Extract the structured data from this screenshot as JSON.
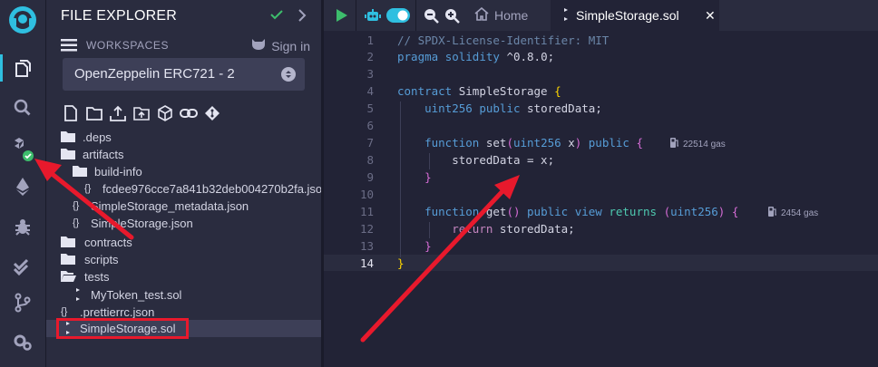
{
  "explorer": {
    "title": "FILE EXPLORER",
    "workspaces_label": "WORKSPACES",
    "sign_in_label": "Sign in",
    "workspace_selected": "OpenZeppelin ERC721 - 2"
  },
  "tree": [
    {
      "label": ".deps",
      "kind": "folder"
    },
    {
      "label": "artifacts",
      "kind": "folder"
    },
    {
      "label": "build-info",
      "kind": "folder"
    },
    {
      "label": "fcdee976cce7a841b32deb004270b2fa.json",
      "kind": "json"
    },
    {
      "label": "SimpleStorage_metadata.json",
      "kind": "json"
    },
    {
      "label": "SimpleStorage.json",
      "kind": "json"
    },
    {
      "label": "contracts",
      "kind": "folder"
    },
    {
      "label": "scripts",
      "kind": "folder"
    },
    {
      "label": "tests",
      "kind": "folder-open"
    },
    {
      "label": "MyToken_test.sol",
      "kind": "sol"
    },
    {
      "label": ".prettierrc.json",
      "kind": "json"
    },
    {
      "label": "SimpleStorage.sol",
      "kind": "sol",
      "selected": true
    }
  ],
  "tabs": {
    "home_label": "Home",
    "active_label": "SimpleStorage.sol",
    "close_glyph": "✕"
  },
  "editor": {
    "line_numbers": [
      "1",
      "2",
      "3",
      "4",
      "5",
      "6",
      "7",
      "8",
      "9",
      "10",
      "11",
      "12",
      "13",
      "14"
    ],
    "current_line": 14,
    "gas_set": "22514 gas",
    "gas_get": "2454 gas"
  },
  "colors": {
    "accent_green": "#3dbd6c",
    "highlight_red": "#e8192c",
    "toggle_blue": "#2fbfe0"
  },
  "icons": [
    "remix-logo-icon",
    "file-explorer-icon",
    "search-icon",
    "solidity-compiler-icon",
    "deploy-icon",
    "debugger-icon",
    "test-icon",
    "git-icon",
    "settings-icon",
    "hamburger-icon",
    "github-icon",
    "check-icon",
    "chevron-right-icon",
    "play-icon",
    "robot-icon",
    "toggle-icon",
    "zoom-out-icon",
    "zoom-in-icon",
    "home-icon",
    "solidity-file-icon",
    "gas-pump-icon"
  ]
}
